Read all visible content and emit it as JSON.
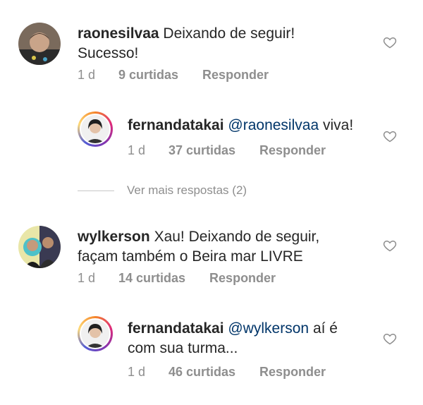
{
  "comments": [
    {
      "username": "raonesilvaa",
      "text_line1": "Deixando de seguir!",
      "text_line2": "Sucesso!",
      "time": "1 d",
      "likes": "9 curtidas",
      "reply": "Responder"
    },
    {
      "username": "fernandatakai",
      "mention": "@raonesilvaa",
      "text": "viva!",
      "time": "1 d",
      "likes": "37 curtidas",
      "reply": "Responder"
    },
    {
      "username": "wylkerson",
      "text_line1": "Xau! Deixando de seguir,",
      "text_line2": "façam também o Beira mar LIVRE",
      "time": "1 d",
      "likes": "14 curtidas",
      "reply": "Responder"
    },
    {
      "username": "fernandatakai",
      "mention": "@wylkerson",
      "text_line1": "aí é",
      "text_line2": "com sua turma...",
      "time": "1 d",
      "likes": "46 curtidas",
      "reply": "Responder"
    }
  ],
  "more_replies": "Ver mais respostas (2)",
  "icons": {
    "like": "heart-outline-icon"
  },
  "colors": {
    "mention": "#003569",
    "meta": "#8e8e8e"
  }
}
